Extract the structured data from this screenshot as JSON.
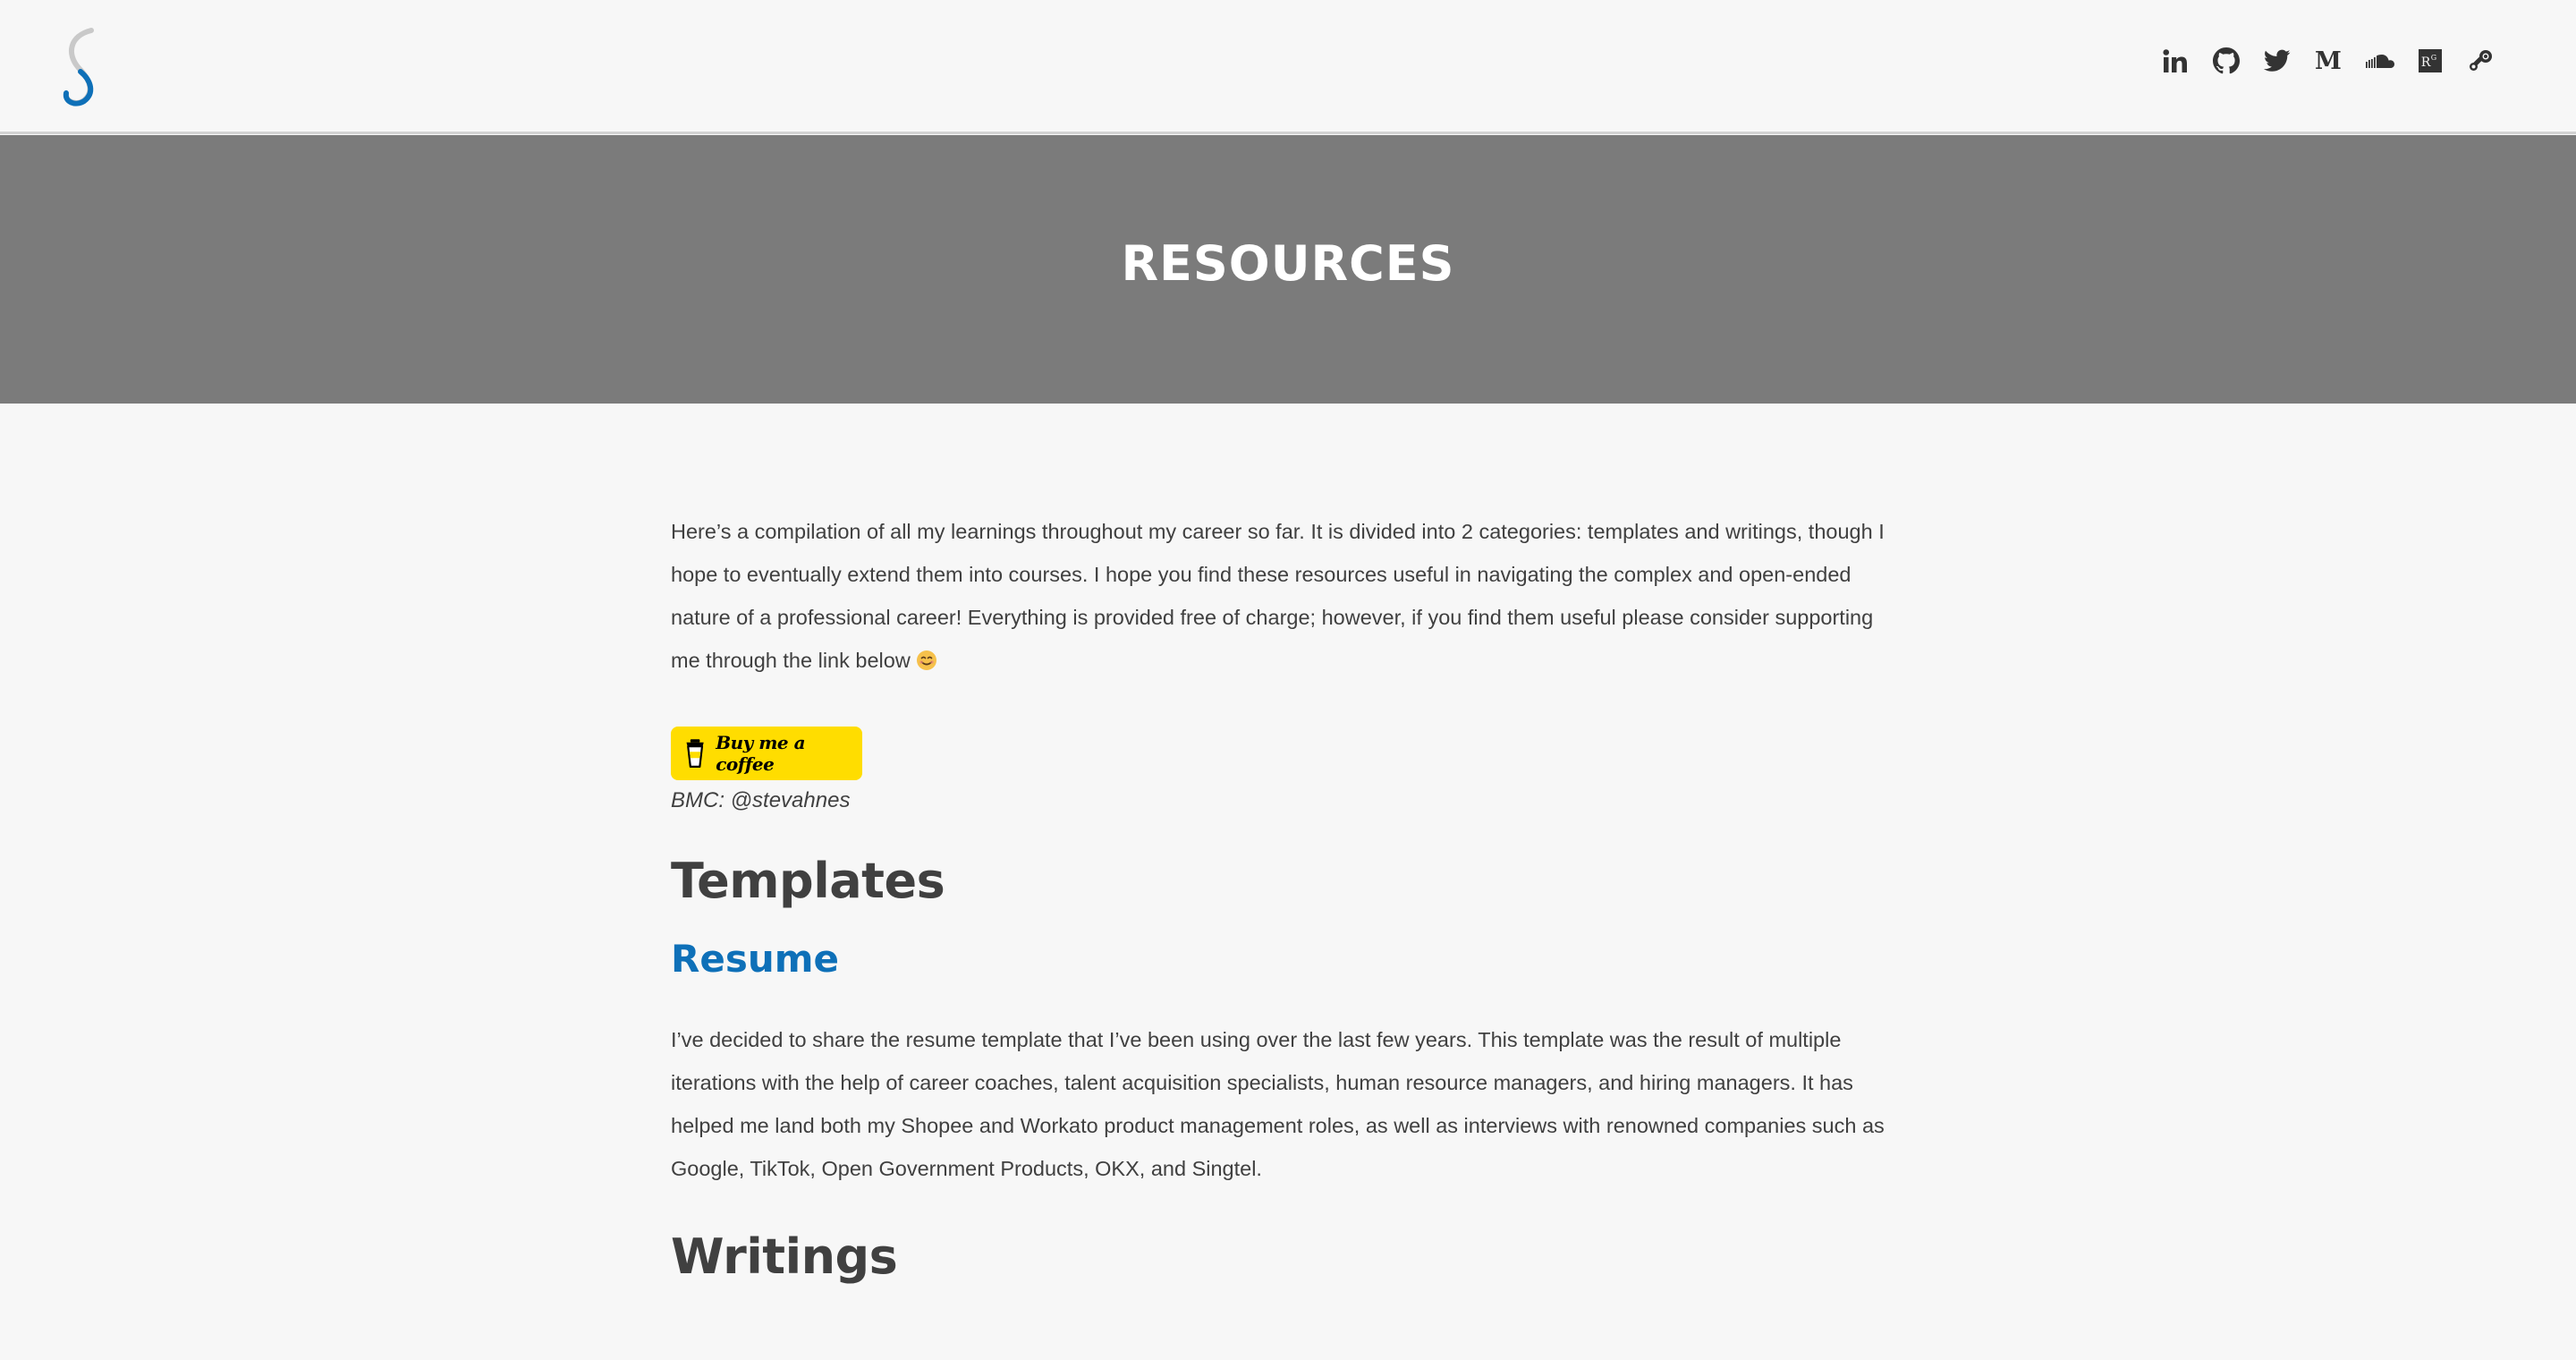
{
  "header": {
    "logo_alt": "S",
    "social_icons": [
      {
        "name": "linkedin-icon",
        "label": "LinkedIn"
      },
      {
        "name": "github-icon",
        "label": "GitHub"
      },
      {
        "name": "twitter-icon",
        "label": "Twitter"
      },
      {
        "name": "medium-icon",
        "label": "Medium"
      },
      {
        "name": "soundcloud-icon",
        "label": "SoundCloud"
      },
      {
        "name": "researchgate-icon",
        "label": "ResearchGate"
      },
      {
        "name": "steam-icon",
        "label": "Steam"
      }
    ]
  },
  "hero": {
    "title": "RESOURCES"
  },
  "main": {
    "intro": "Here’s a compilation of all my learnings throughout my career so far. It is divided into 2 categories: templates and writings, though I hope to eventually extend them into courses. I hope you find these resources useful in navigating the complex and open-ended nature of a professional career! Everything is provided free of charge; however, if you find them useful please consider supporting me through the link below",
    "coffee_button_label": "Buy me a coffee",
    "bmc_handle": "BMC: @stevahnes",
    "templates_heading": "Templates",
    "resume_heading": "Resume",
    "resume_text": "I’ve decided to share the resume template that I’ve been using over the last few years. This template was the result of multiple iterations with the help of career coaches, talent acquisition specialists, human resource managers, and hiring managers. It has helped me land both my Shopee and Workato product management roles, as well as interviews with renowned companies such as Google, TikTok, Open Government Products, OKX, and Singtel.",
    "writings_heading": "Writings"
  },
  "colors": {
    "hero_bg": "#7b7b7b",
    "accent_blue": "#0e70b8",
    "coffee_yellow": "#ffdd00",
    "page_bg": "#f7f7f7"
  }
}
